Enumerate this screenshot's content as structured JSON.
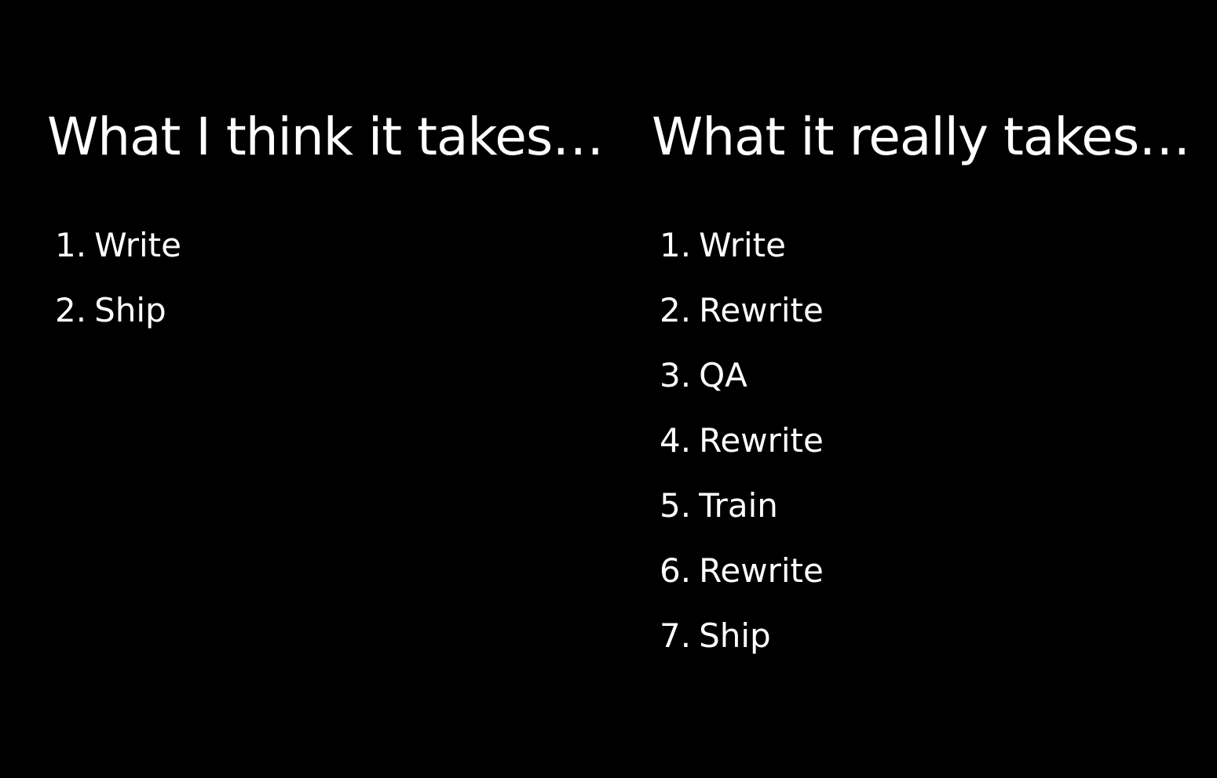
{
  "left": {
    "heading": "What I think it takes…",
    "steps": [
      {
        "num": "1.",
        "label": "Write"
      },
      {
        "num": "2.",
        "label": "Ship"
      }
    ]
  },
  "right": {
    "heading": "What it really takes…",
    "steps": [
      {
        "num": "1.",
        "label": "Write"
      },
      {
        "num": "2.",
        "label": "Rewrite"
      },
      {
        "num": "3.",
        "label": "QA"
      },
      {
        "num": "4.",
        "label": "Rewrite"
      },
      {
        "num": "5.",
        "label": "Train"
      },
      {
        "num": "6.",
        "label": "Rewrite"
      },
      {
        "num": "7.",
        "label": "Ship"
      }
    ]
  },
  "colors": {
    "background": "#000000",
    "text": "#ffffff"
  }
}
